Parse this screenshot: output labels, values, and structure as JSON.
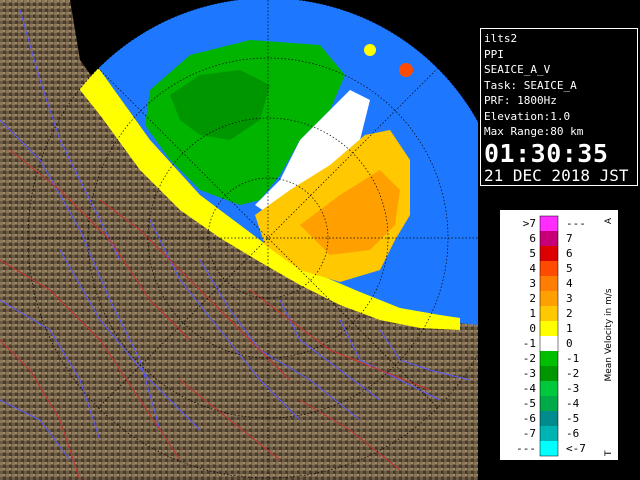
{
  "info": {
    "site": "ilts2",
    "mode": "PPI",
    "product": "SEAICE_A_V",
    "task": "Task: SEAICE_A",
    "prf": "PRF: 1800Hz",
    "elevation": "Elevation:1.0",
    "max_range": "Max Range:80 km",
    "time": "01:30:35",
    "date": "21 DEC 2018 JST"
  },
  "legend": {
    "title": "Mean Velocity in m/s",
    "top_marker": "A",
    "bottom_marker": "T",
    "classes": [
      {
        "left": ">7",
        "right": "---",
        "color": "#ff2cff"
      },
      {
        "left": "6",
        "right": "7",
        "color": "#c80078"
      },
      {
        "left": "5",
        "right": "6",
        "color": "#dc0000"
      },
      {
        "left": "4",
        "right": "5",
        "color": "#ff4b00"
      },
      {
        "left": "3",
        "right": "4",
        "color": "#ff7d00"
      },
      {
        "left": "2",
        "right": "3",
        "color": "#ffa000"
      },
      {
        "left": "1",
        "right": "2",
        "color": "#ffc800"
      },
      {
        "left": "0",
        "right": "1",
        "color": "#ffff00"
      },
      {
        "left": "-1",
        "right": "0",
        "color": "#ffffff"
      },
      {
        "left": "-2",
        "right": "-1",
        "color": "#00be00"
      },
      {
        "left": "-3",
        "right": "-2",
        "color": "#009600"
      },
      {
        "left": "-4",
        "right": "-3",
        "color": "#00c83c"
      },
      {
        "left": "-5",
        "right": "-4",
        "color": "#00aa46"
      },
      {
        "left": "-6",
        "right": "-5",
        "color": "#008c8c"
      },
      {
        "left": "-7",
        "right": "-6",
        "color": "#00b4b4"
      },
      {
        "left": "---",
        "right": "<-7",
        "color": "#00ffff"
      }
    ]
  },
  "colors": {
    "range_fill": "#1e78ff",
    "land": "#6b5a44",
    "rivers": "#5a5aff",
    "boundaries": "#c83232",
    "range_rings": "#000000"
  }
}
